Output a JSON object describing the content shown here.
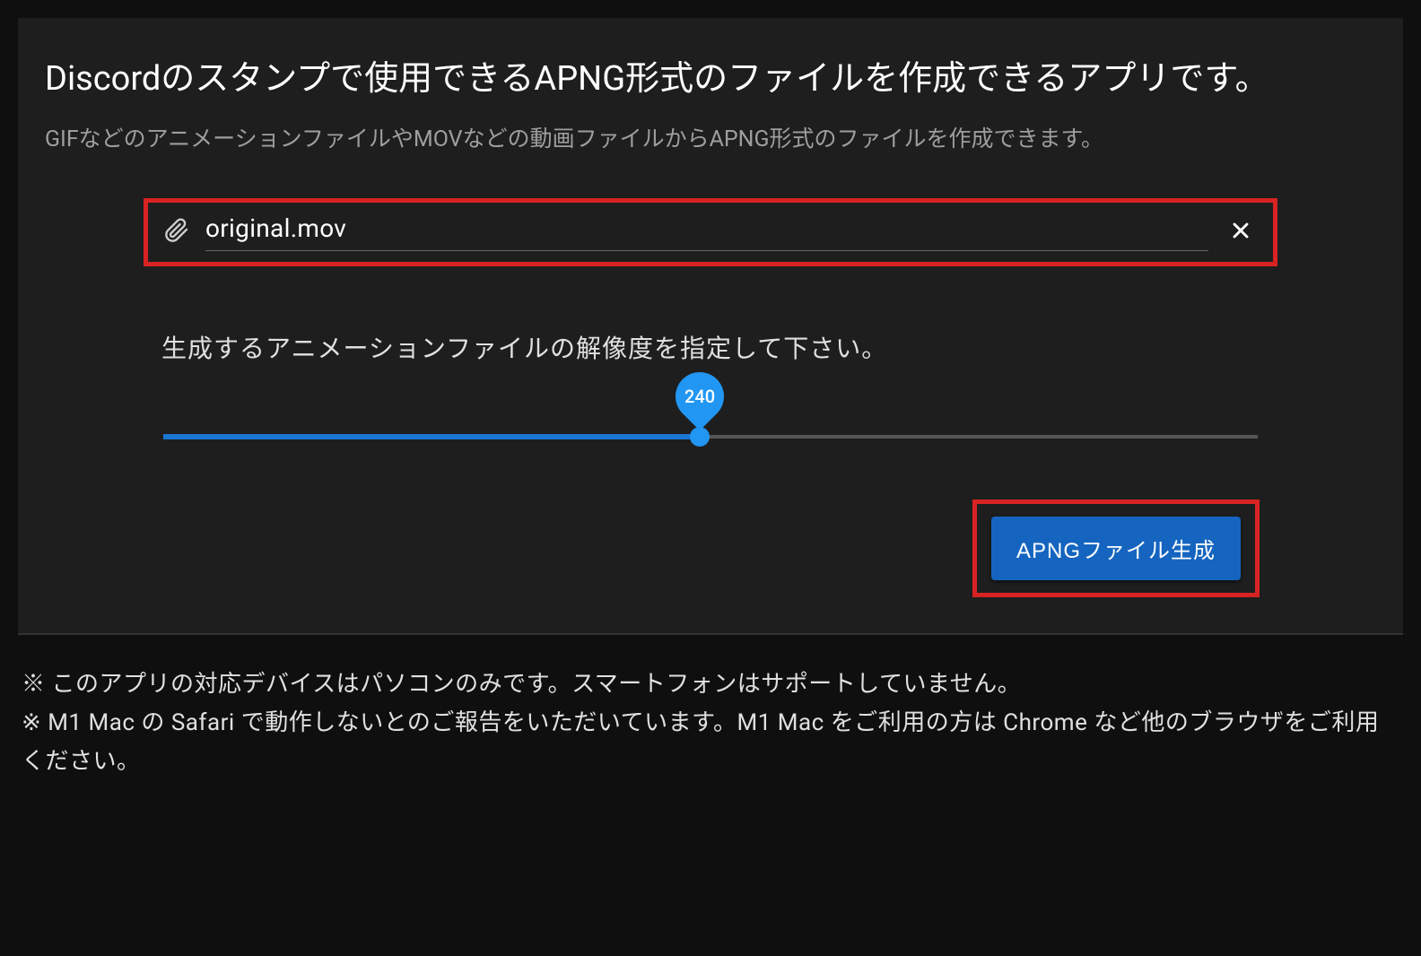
{
  "card": {
    "heading": "Discordのスタンプで使用できるAPNG形式のファイルを作成できるアプリです。",
    "subtitle": "GIFなどのアニメーションファイルやMOVなどの動画ファイルからAPNG形式のファイルを作成できます。"
  },
  "file": {
    "name": "original.mov"
  },
  "resolution": {
    "label": "生成するアニメーションファイルの解像度を指定して下さい。",
    "value": "240",
    "percent": 49
  },
  "actions": {
    "generate_label": "APNGファイル生成"
  },
  "notes": {
    "line1": "※ このアプリの対応デバイスはパソコンのみです。スマートフォンはサポートしていません。",
    "line2": "※ M1 Mac の Safari で動作しないとのご報告をいただいています。M1 Mac をご利用の方は Chrome など他のブラウザをご利用ください。"
  }
}
